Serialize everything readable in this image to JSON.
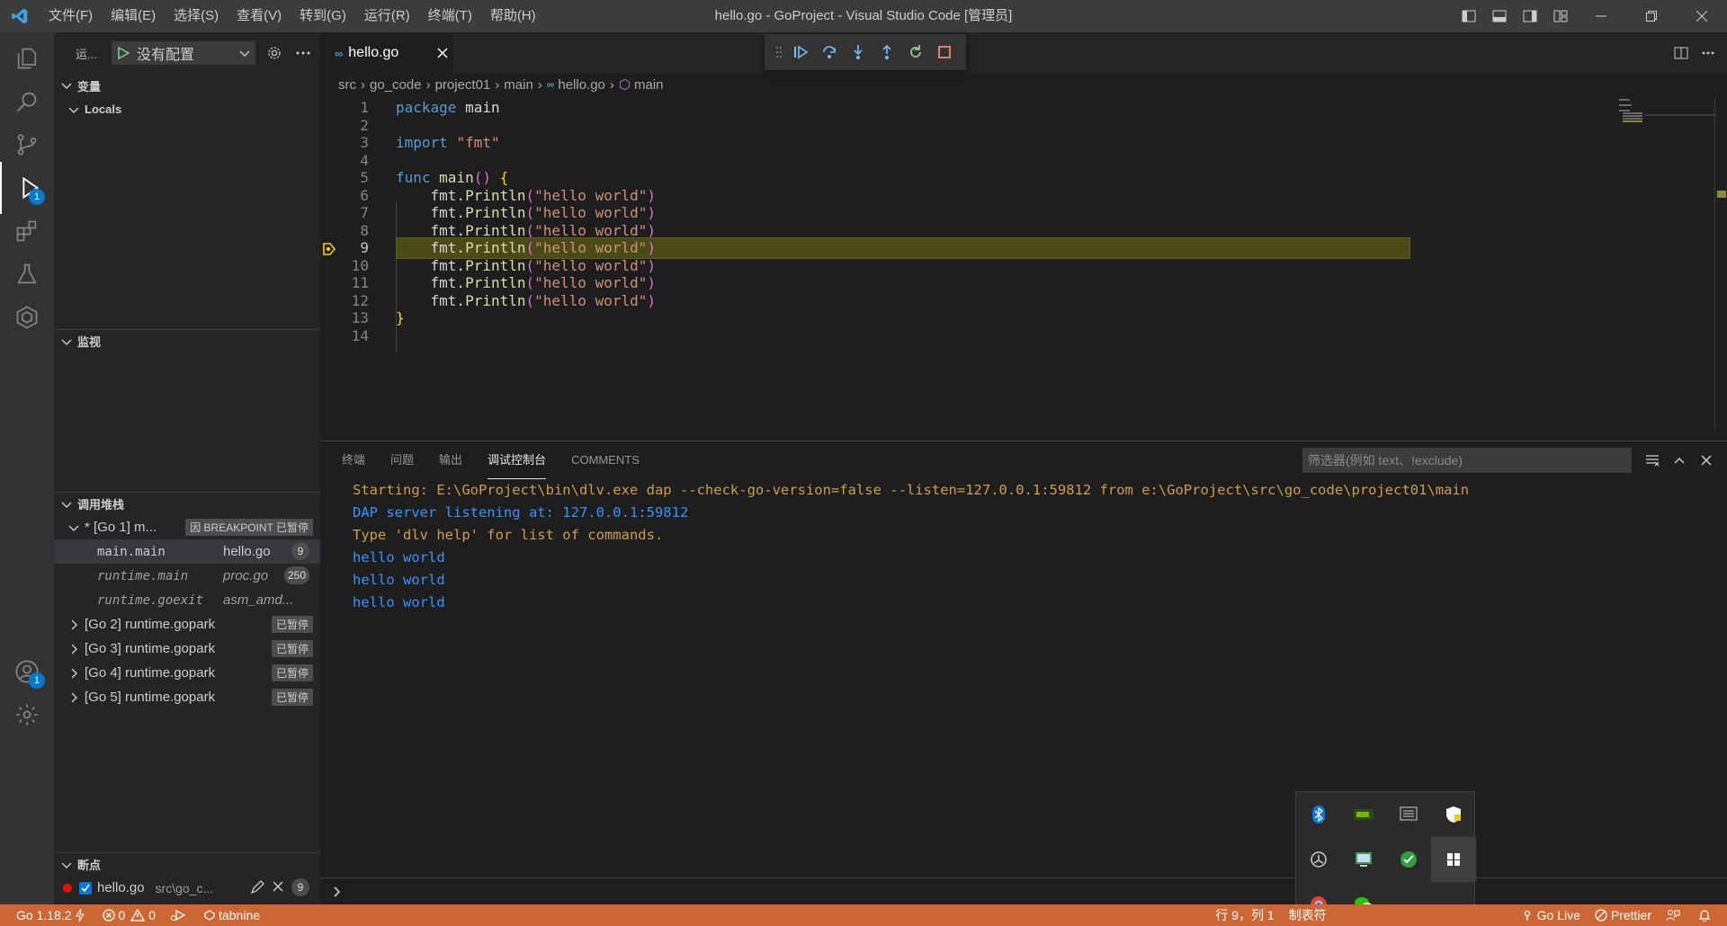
{
  "window": {
    "title": "hello.go - GoProject - Visual Studio Code [管理员]"
  },
  "menu": [
    "文件(F)",
    "编辑(E)",
    "选择(S)",
    "查看(V)",
    "转到(G)",
    "运行(R)",
    "终端(T)",
    "帮助(H)"
  ],
  "activity": {
    "run_badge": "1",
    "accounts_badge": "1"
  },
  "sidebar": {
    "run_title": "运...",
    "config_label": "没有配置",
    "variables_title": "变量",
    "locals_label": "Locals",
    "watch_title": "监视",
    "callstack_title": "调用堆栈",
    "threads": [
      {
        "label": "* [Go 1] m...",
        "state": "因 BREAKPOINT 已暂停"
      },
      {
        "label": "[Go 2] runtime.gopark",
        "state": "已暂停"
      },
      {
        "label": "[Go 3] runtime.gopark",
        "state": "已暂停"
      },
      {
        "label": "[Go 4] runtime.gopark",
        "state": "已暂停"
      },
      {
        "label": "[Go 5] runtime.gopark",
        "state": "已暂停"
      }
    ],
    "frames": [
      {
        "fn": "main.main",
        "file": "hello.go",
        "line": "9"
      },
      {
        "fn": "runtime.main",
        "file": "proc.go",
        "line": "250"
      },
      {
        "fn": "runtime.goexit",
        "file": "asm_amd...",
        "line": ""
      }
    ],
    "breakpoints_title": "断点",
    "breakpoint": {
      "file": "hello.go",
      "path": "src\\go_c...",
      "line": "9"
    }
  },
  "editor": {
    "tab_label": "hello.go",
    "breadcrumb": [
      "src",
      "go_code",
      "project01",
      "main",
      "hello.go",
      "main"
    ],
    "lines": [
      {
        "n": "1",
        "text": "package main"
      },
      {
        "n": "2",
        "text": ""
      },
      {
        "n": "3",
        "text": "import \"fmt\""
      },
      {
        "n": "4",
        "text": ""
      },
      {
        "n": "5",
        "text": "func main() {"
      },
      {
        "n": "6",
        "text": "    fmt.Println(\"hello world\")"
      },
      {
        "n": "7",
        "text": "    fmt.Println(\"hello world\")"
      },
      {
        "n": "8",
        "text": "    fmt.Println(\"hello world\")"
      },
      {
        "n": "9",
        "text": "    fmt.Println(\"hello world\")"
      },
      {
        "n": "10",
        "text": "    fmt.Println(\"hello world\")"
      },
      {
        "n": "11",
        "text": "    fmt.Println(\"hello world\")"
      },
      {
        "n": "12",
        "text": "    fmt.Println(\"hello world\")"
      },
      {
        "n": "13",
        "text": "}"
      },
      {
        "n": "14",
        "text": ""
      }
    ],
    "current_line": "9"
  },
  "panel": {
    "tabs": [
      "终端",
      "问题",
      "输出",
      "调试控制台",
      "COMMENTS"
    ],
    "active_tab": "调试控制台",
    "filter_placeholder": "筛选器(例如 text、!exclude)",
    "console": [
      {
        "text": "Starting: E:\\GoProject\\bin\\dlv.exe dap --check-go-version=false --listen=127.0.0.1:59812 from e:\\GoProject\\src\\go_code\\project01\\main",
        "color": "orange"
      },
      {
        "text": "DAP server listening at: 127.0.0.1:59812",
        "color": "blue"
      },
      {
        "text": "Type 'dlv help' for list of commands.",
        "color": "orange"
      },
      {
        "text": "hello world",
        "color": "blue"
      },
      {
        "text": "hello world",
        "color": "blue"
      },
      {
        "text": "hello world",
        "color": "blue"
      }
    ]
  },
  "statusbar": {
    "go_version": "Go 1.18.2",
    "errors": "0",
    "warnings": "0",
    "tabnine": "tabnine",
    "position": "行 9，列 1",
    "indent": "制表符",
    "golive": "Go Live",
    "prettier": "Prettier"
  },
  "colors": {
    "statusbar": "#cc6633",
    "accent": "#007acc",
    "current_line_bg": "#4b4b18"
  }
}
